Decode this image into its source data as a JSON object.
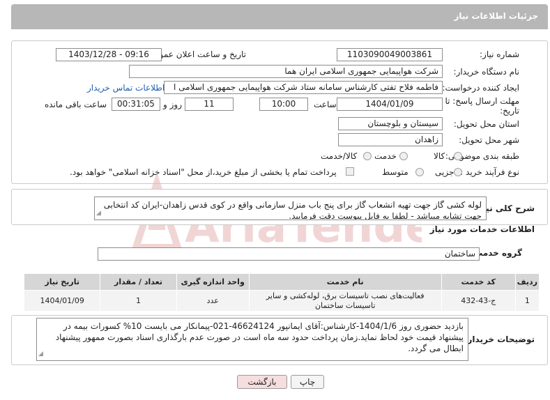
{
  "page": {
    "title": "جزئیات اطلاعات نیاز"
  },
  "form": {
    "need_number_label": "شماره نیاز:",
    "need_number": "1103090049003861",
    "announce_label": "تاریخ و ساعت اعلان عمومی:",
    "announce_value": "1403/12/28 - 09:16",
    "buyer_org_label": "نام دستگاه خریدار:",
    "buyer_org": "شرکت هواپیمایی جمهوری اسلامی ایران هما",
    "requester_label": "ایجاد کننده درخواست:",
    "requester": "فاطمه فلاح تفتی کارشناس سامانه ستاد شرکت هواپیمایی جمهوری اسلامی ا",
    "contact_link": "اطلاعات تماس خریدار",
    "deadline_label_1": "مهلت ارسال پاسخ: تا",
    "deadline_label_2": "تاریخ:",
    "deadline_date": "1404/01/09",
    "time_label": "ساعت",
    "deadline_time": "10:00",
    "days_value": "11",
    "days_label": "روز و",
    "remaining_time": "00:31:05",
    "remaining_label": "ساعت باقی مانده",
    "province_label": "استان محل تحویل:",
    "province": "سیستان و بلوچستان",
    "city_label": "شهر محل تحویل:",
    "city": "زاهدان",
    "category_label": "طبقه بندی موضوعی:",
    "category_options": [
      "کالا",
      "خدمت",
      "کالا/خدمت"
    ],
    "process_label": "نوع فرآیند خرید :",
    "process_options": [
      "جزیی",
      "متوسط"
    ],
    "payment_note": "پرداخت تمام یا بخشی از مبلغ خرید،از محل \"اسناد خزانه اسلامی\" خواهد بود."
  },
  "description": {
    "label": "شرح کلی نیاز:",
    "text": "لوله کشی گاز جهت تهیه انشعاب گاز برای پنج باب منزل سازمانی واقع در کوی قدس زاهدان-ایران کد انتخابی جهت تشابه میباشد - لطفا به فایل پیوست دقت فرمایید."
  },
  "services": {
    "section_title": "اطلاعات خدمات مورد نیاز",
    "group_label": "گروه خدمت:",
    "group_value": "ساختمان",
    "columns": [
      "ردیف",
      "کد خدمت",
      "نام خدمت",
      "واحد اندازه گیری",
      "تعداد / مقدار",
      "تاریخ نیاز"
    ],
    "rows": [
      [
        "1",
        "ج-43-432",
        "فعالیت‌های نصب تاسیسات برق، لوله‌کشی و سایر تاسیسات ساختمان",
        "عدد",
        "1",
        "1404/01/09"
      ]
    ]
  },
  "buyer_notes": {
    "label": "توضیحات خریدار:",
    "text": "بازدید حضوری روز 1404/1/6-کارشناس:آقای ایمانپور 46624124-021-پیمانکار می بایست 10% کسورات بیمه در پیشنهاد قیمت خود لحاظ نماید.زمان پرداخت حدود سه ماه است در صورت عدم بارگذاری اسناد بصورت ممهور پیشنهاد ابطال می گردد."
  },
  "buttons": {
    "print": "چاپ",
    "back": "بازگشت"
  },
  "watermark": {
    "text": "AriaTender.neT"
  },
  "colors": {
    "header": "#b7b7b7",
    "link": "#1f5fb0",
    "back_button": "#f6dede",
    "watermark": "#e6b3b3"
  }
}
